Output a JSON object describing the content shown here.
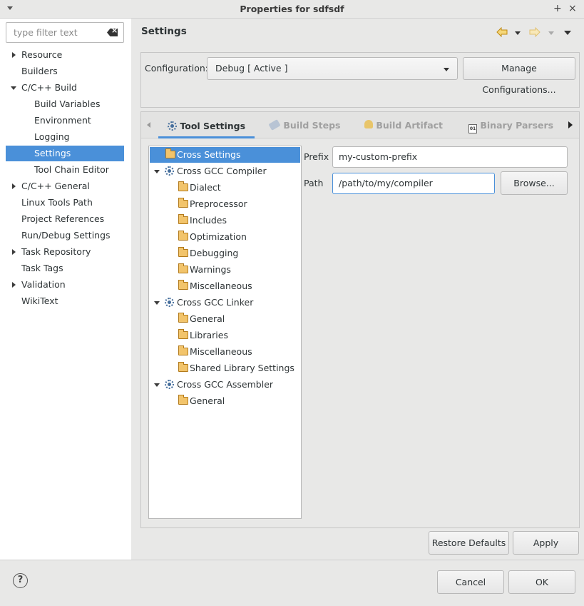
{
  "window": {
    "title": "Properties for sdfsdf",
    "pin": "+",
    "close": "×"
  },
  "filter": {
    "placeholder": "type filter text",
    "value": ""
  },
  "sidebar": {
    "items": [
      {
        "label": "Resource"
      },
      {
        "label": "Builders"
      },
      {
        "label": "C/C++ Build"
      },
      {
        "label": "Build Variables"
      },
      {
        "label": "Environment"
      },
      {
        "label": "Logging"
      },
      {
        "label": "Settings"
      },
      {
        "label": "Tool Chain Editor"
      },
      {
        "label": "C/C++ General"
      },
      {
        "label": "Linux Tools Path"
      },
      {
        "label": "Project References"
      },
      {
        "label": "Run/Debug Settings"
      },
      {
        "label": "Task Repository"
      },
      {
        "label": "Task Tags"
      },
      {
        "label": "Validation"
      },
      {
        "label": "WikiText"
      }
    ]
  },
  "header": {
    "title": "Settings"
  },
  "config": {
    "label": "Configuration:",
    "selected": "Debug  [ Active ]",
    "manage_button": "Manage Configurations..."
  },
  "tabs": [
    {
      "label": "Tool Settings"
    },
    {
      "label": "Build Steps"
    },
    {
      "label": "Build Artifact"
    },
    {
      "label": "Binary Parsers"
    }
  ],
  "tool_tree": [
    {
      "label": "Cross Settings"
    },
    {
      "label": "Cross GCC Compiler"
    },
    {
      "label": "Dialect"
    },
    {
      "label": "Preprocessor"
    },
    {
      "label": "Includes"
    },
    {
      "label": "Optimization"
    },
    {
      "label": "Debugging"
    },
    {
      "label": "Warnings"
    },
    {
      "label": "Miscellaneous"
    },
    {
      "label": "Cross GCC Linker"
    },
    {
      "label": "General"
    },
    {
      "label": "Libraries"
    },
    {
      "label": "Miscellaneous"
    },
    {
      "label": "Shared Library Settings"
    },
    {
      "label": "Cross GCC Assembler"
    },
    {
      "label": "General"
    }
  ],
  "fields": {
    "prefix_label": "Prefix",
    "prefix_value": "my-custom-prefix",
    "path_label": "Path",
    "path_value": "/path/to/my/compiler",
    "browse_button": "Browse..."
  },
  "buttons": {
    "restore_defaults": "Restore Defaults",
    "apply": "Apply",
    "cancel": "Cancel",
    "ok": "OK",
    "help": "?"
  },
  "colors": {
    "selection": "#4a90d9",
    "nav_arrow": "#e0a020"
  }
}
